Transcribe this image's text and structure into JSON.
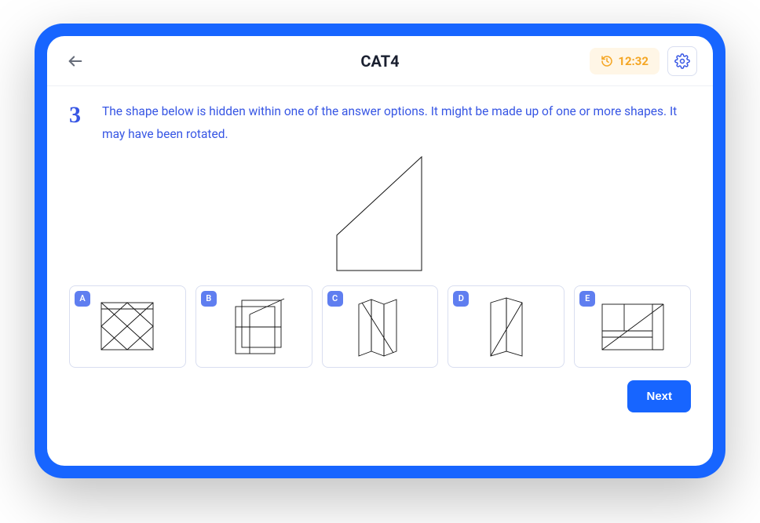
{
  "header": {
    "title": "CAT4",
    "timer": "12:32"
  },
  "question": {
    "number": "3",
    "text": "The shape below is hidden within one of the answer options. It might be made up of one or more shapes. It may have been rotated."
  },
  "options": {
    "a": "A",
    "b": "B",
    "c": "C",
    "d": "D",
    "e": "E"
  },
  "footer": {
    "next_label": "Next"
  },
  "colors": {
    "primary": "#1765ff",
    "accent": "#3756e4",
    "timer_bg": "#fff6e6",
    "timer_fg": "#f5a623",
    "border": "#d9def0"
  }
}
